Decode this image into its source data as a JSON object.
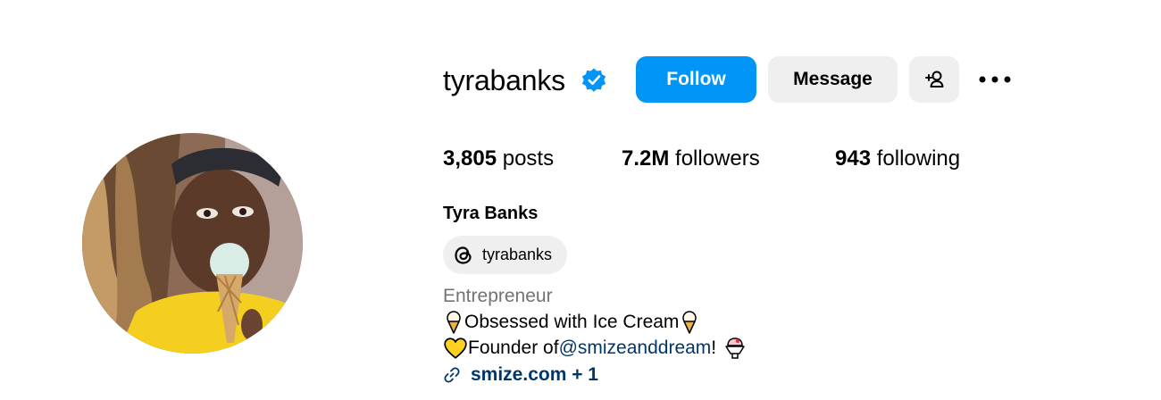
{
  "profile": {
    "username": "tyrabanks",
    "full_name": "Tyra Banks",
    "verified": true,
    "accent_color": "#0095f6"
  },
  "actions": {
    "follow_label": "Follow",
    "message_label": "Message"
  },
  "stats": {
    "posts_count": "3,805",
    "posts_label": "posts",
    "followers_count": "7.2M",
    "followers_label": "followers",
    "following_count": "943",
    "following_label": "following"
  },
  "threads": {
    "handle": "tyrabanks",
    "icon": "threads-icon"
  },
  "bio": {
    "category": "Entrepreneur",
    "line1_text": "Obsessed with Ice Cream",
    "line2_prefix": "Founder of ",
    "line2_mention": "@smizeanddream",
    "line2_suffix": "!",
    "link_text": "smize.com + 1"
  },
  "colors": {
    "link": "#00376b",
    "muted": "#737373",
    "button_gray": "#efefef"
  }
}
